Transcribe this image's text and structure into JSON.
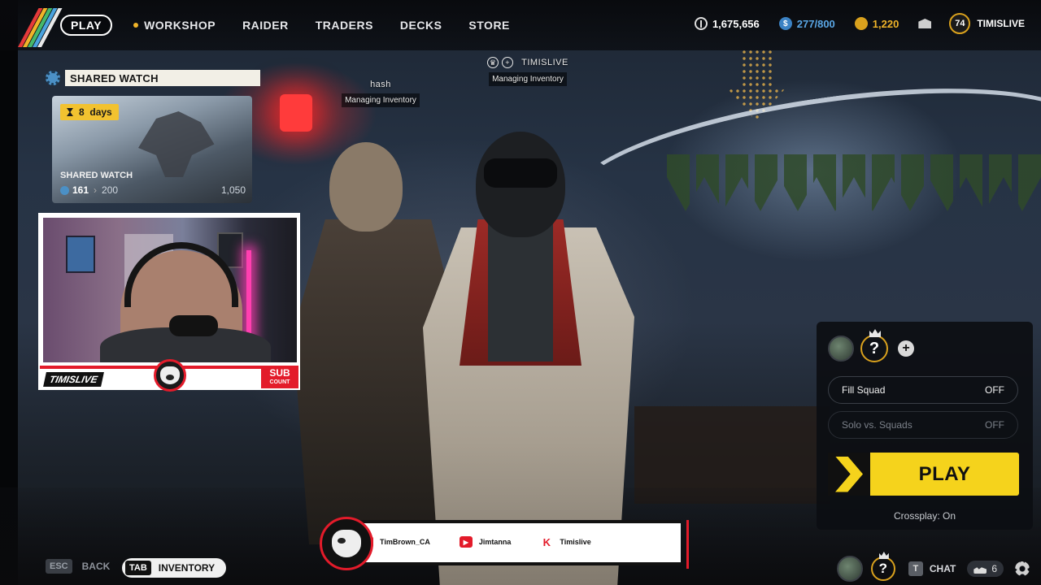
{
  "nav": {
    "items": [
      {
        "label": "PLAY",
        "active": true
      },
      {
        "label": "WORKSHOP",
        "dot": true
      },
      {
        "label": "RAIDER"
      },
      {
        "label": "TRADERS"
      },
      {
        "label": "DECKS"
      },
      {
        "label": "STORE"
      }
    ]
  },
  "currency": {
    "coins": "1,675,656",
    "tokens": "277/800",
    "gold": "1,220",
    "tokens_color": "#5aa7e6",
    "gold_color": "#f0b429"
  },
  "profile": {
    "level": "74",
    "username": "TIMISLIVE"
  },
  "shared_watch": {
    "title": "SHARED WATCH",
    "days": "8",
    "days_unit": "days",
    "card_name": "SHARED WATCH",
    "progress_current": "161",
    "progress_next": "200",
    "progress_max": "1,050"
  },
  "webcam": {
    "name": "TIMISLIVE",
    "sub_label": "SUB",
    "sub_small": "COUNT"
  },
  "players": [
    {
      "name": "hash",
      "status": "Managing Inventory"
    },
    {
      "name": "TIMISLIVE",
      "status": "Managing Inventory"
    }
  ],
  "squad": {
    "unknown_symbol": "?",
    "add_symbol": "+",
    "fill_squad": {
      "label": "Fill Squad",
      "value": "OFF"
    },
    "solo_vs_squads": {
      "label": "Solo vs. Squads",
      "value": "OFF"
    },
    "play_label": "PLAY",
    "crossplay": "Crossplay: On"
  },
  "hints": {
    "back_key": "ESC",
    "back_label": "BACK",
    "inventory_key": "TAB",
    "inventory_label": "INVENTORY"
  },
  "social": {
    "items": [
      {
        "icon": "x-icon",
        "label": "TimBrown_CA"
      },
      {
        "icon": "youtube-icon",
        "label": "Jimtanna"
      },
      {
        "icon": "kick-icon",
        "label": "Timislive"
      }
    ]
  },
  "bottom_right": {
    "unknown_symbol": "?",
    "chat_key": "T",
    "chat_label": "CHAT",
    "friends_count": "6"
  },
  "colors": {
    "accent_yellow": "#f5d31c",
    "brand_red": "#e31b2a"
  }
}
